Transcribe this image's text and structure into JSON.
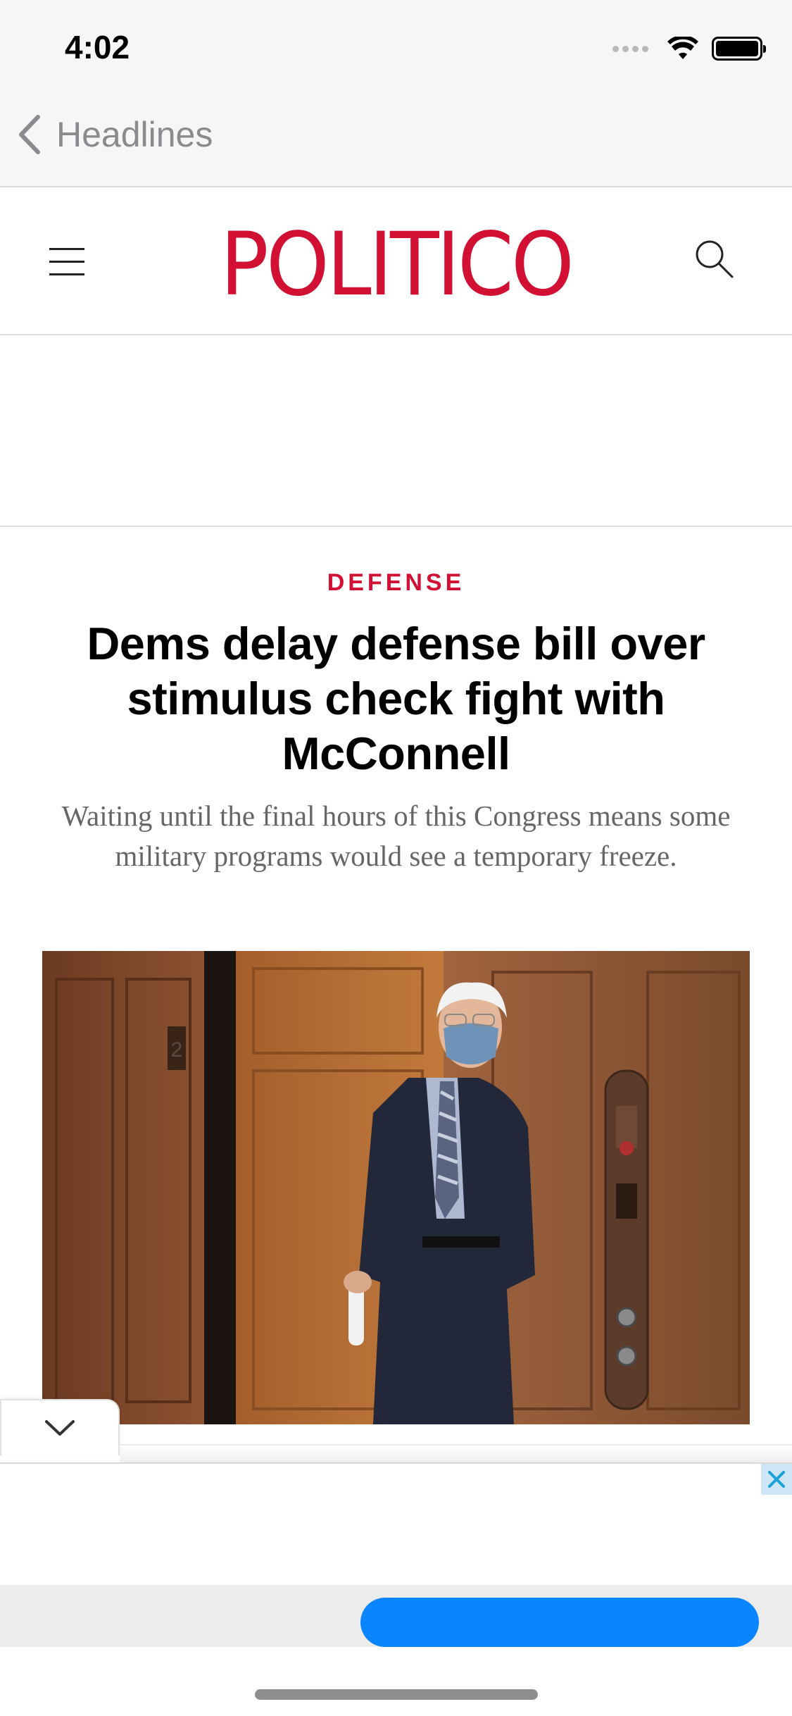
{
  "status_bar": {
    "time": "4:02"
  },
  "nav": {
    "back_label": "Headlines"
  },
  "header": {
    "logo_text": "POLITICO",
    "brand_color": "#d21034"
  },
  "article": {
    "section": "DEFENSE",
    "headline": "Dems delay defense bill over stimulus check fight with McConnell",
    "dek": "Waiting until the final hours of this Congress means some military programs would see a temporary freeze.",
    "image_floor_label": "2"
  },
  "icons": {
    "back": "chevron-left-icon",
    "menu": "hamburger-menu-icon",
    "search": "search-icon",
    "collapse": "chevron-down-icon",
    "close": "close-icon"
  },
  "colors": {
    "accent": "#d21034",
    "cta_blue": "#0a84ff",
    "close_x": "#1a9fd9"
  }
}
